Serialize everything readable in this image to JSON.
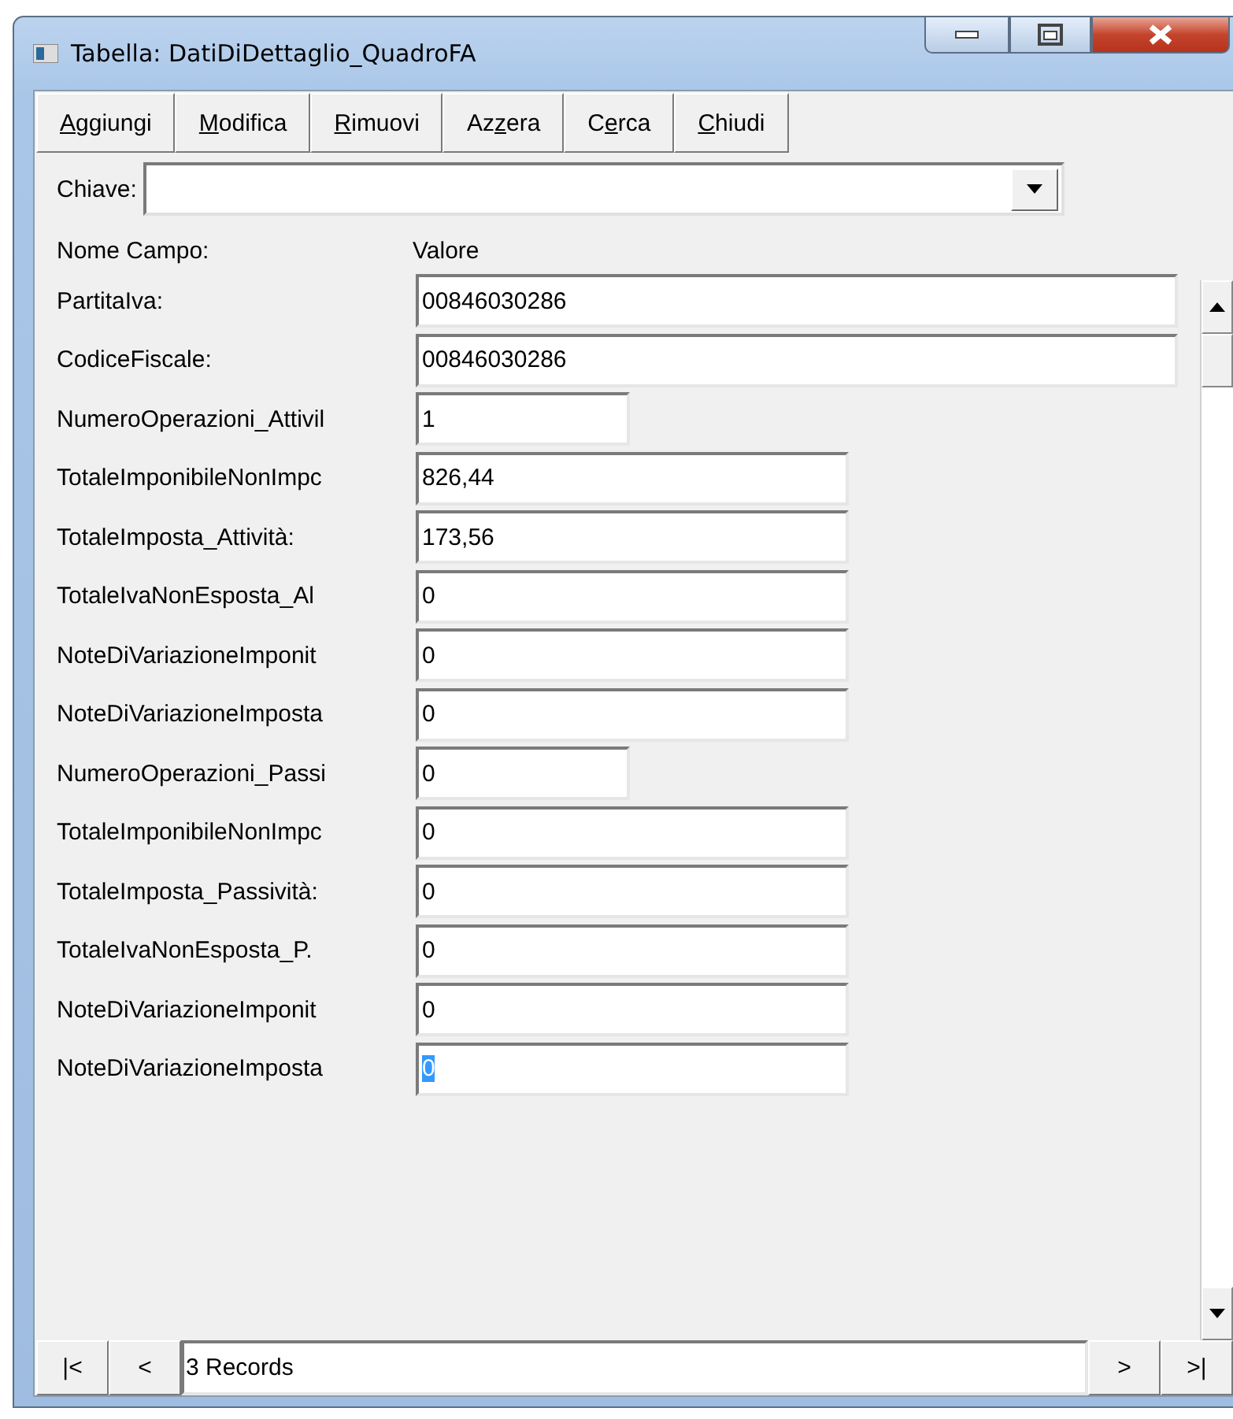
{
  "window": {
    "title": "Tabella: DatiDiDettaglio_QuadroFA"
  },
  "toolbar": [
    {
      "accel": "A",
      "after": "ggiungi"
    },
    {
      "accel": "M",
      "after": "odifica"
    },
    {
      "accel": "R",
      "after": "imuovi"
    },
    {
      "before": "Az",
      "accel": "z",
      "after": "era"
    },
    {
      "before": "C",
      "accel": "e",
      "after": "rca"
    },
    {
      "accel": "C",
      "after": "hiudi"
    }
  ],
  "key": {
    "label": "Chiave:"
  },
  "header": {
    "name": "Nome Campo:",
    "value": "Valore"
  },
  "fields": [
    {
      "label": "PartitaIva:",
      "value": "00846030286",
      "kind": "wide",
      "selected": false
    },
    {
      "label": "CodiceFiscale:",
      "value": "00846030286",
      "kind": "wide",
      "selected": false
    },
    {
      "label": "NumeroOperazioni_Attivil",
      "value": "1",
      "kind": "short",
      "selected": false
    },
    {
      "label": "TotaleImponibileNonImpc",
      "value": "826,44",
      "kind": "medium",
      "selected": false
    },
    {
      "label": "TotaleImposta_Attività:",
      "value": "173,56",
      "kind": "medium",
      "selected": false
    },
    {
      "label": "TotaleIvaNonEsposta_Al",
      "value": "0",
      "kind": "medium",
      "selected": false
    },
    {
      "label": "NoteDiVariazioneImponit",
      "value": "0",
      "kind": "medium",
      "selected": false
    },
    {
      "label": "NoteDiVariazioneImposta",
      "value": "0",
      "kind": "medium",
      "selected": false
    },
    {
      "label": "NumeroOperazioni_Passi",
      "value": "0",
      "kind": "short",
      "selected": false
    },
    {
      "label": "TotaleImponibileNonImpc",
      "value": "0",
      "kind": "medium",
      "selected": false
    },
    {
      "label": "TotaleImposta_Passività:",
      "value": "0",
      "kind": "medium",
      "selected": false
    },
    {
      "label": "TotaleIvaNonEsposta_P.",
      "value": "0",
      "kind": "medium",
      "selected": false
    },
    {
      "label": "NoteDiVariazioneImponit",
      "value": "0",
      "kind": "medium",
      "selected": false
    },
    {
      "label": "NoteDiVariazioneImposta",
      "value": "0",
      "kind": "medium",
      "selected": true
    }
  ],
  "navigator": {
    "first": "|<",
    "previous": "<",
    "status": "3 Records",
    "next": ">",
    "last": ">|"
  }
}
